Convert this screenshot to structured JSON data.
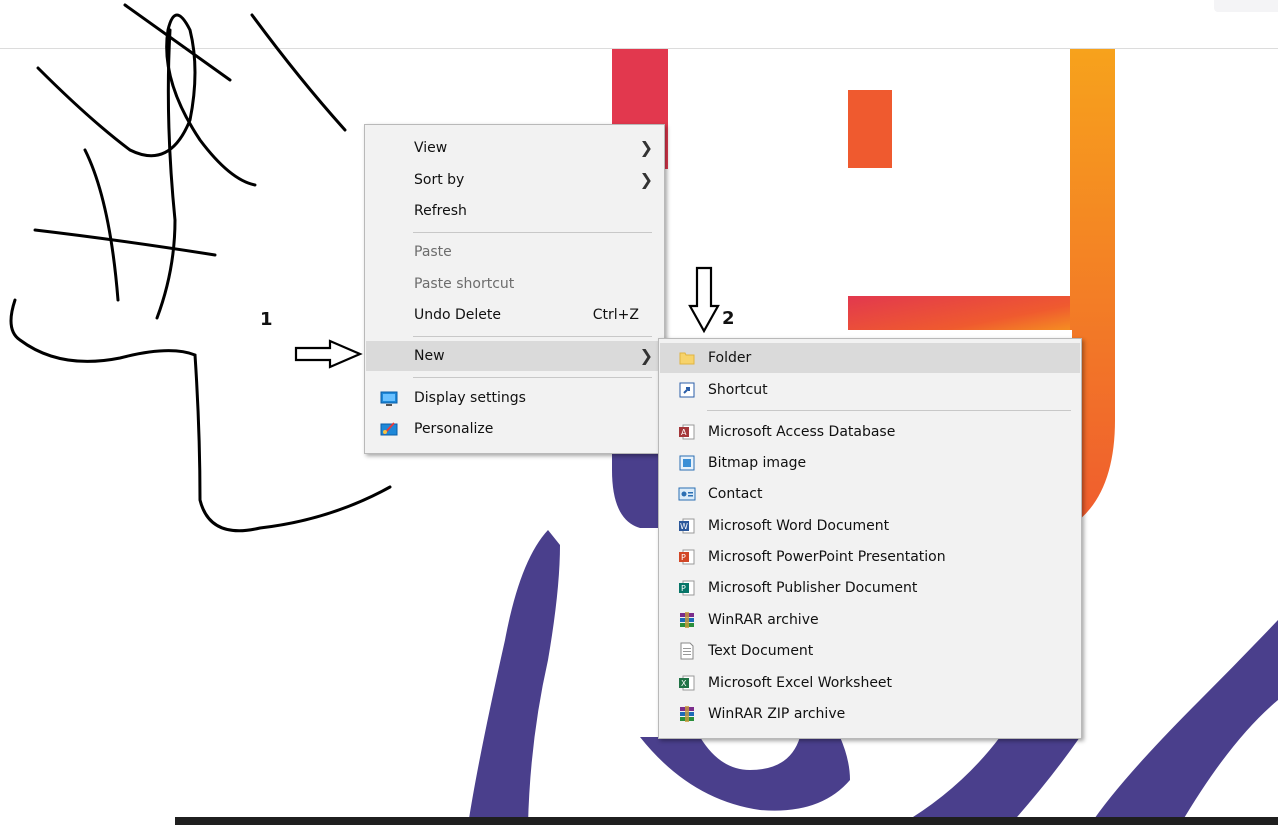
{
  "context_menu": {
    "items": [
      {
        "label": "View",
        "submenu": true
      },
      {
        "label": "Sort by",
        "submenu": true
      },
      {
        "label": "Refresh"
      },
      {
        "label": "Paste",
        "disabled": true
      },
      {
        "label": "Paste shortcut",
        "disabled": true
      },
      {
        "label": "Undo Delete",
        "shortcut": "Ctrl+Z"
      },
      {
        "label": "New",
        "submenu": true,
        "highlighted": true
      },
      {
        "label": "Display settings",
        "icon": "display-icon"
      },
      {
        "label": "Personalize",
        "icon": "personalize-icon"
      }
    ]
  },
  "new_submenu": {
    "items": [
      {
        "label": "Folder",
        "icon": "folder-icon",
        "highlighted": true
      },
      {
        "label": "Shortcut",
        "icon": "shortcut-icon"
      },
      {
        "label": "Microsoft Access Database",
        "icon": "access-icon"
      },
      {
        "label": "Bitmap image",
        "icon": "bitmap-icon"
      },
      {
        "label": "Contact",
        "icon": "contact-icon"
      },
      {
        "label": "Microsoft Word Document",
        "icon": "word-icon"
      },
      {
        "label": "Microsoft PowerPoint Presentation",
        "icon": "powerpoint-icon"
      },
      {
        "label": "Microsoft Publisher Document",
        "icon": "publisher-icon"
      },
      {
        "label": "WinRAR archive",
        "icon": "winrar-icon"
      },
      {
        "label": "Text Document",
        "icon": "text-document-icon"
      },
      {
        "label": "Microsoft Excel Worksheet",
        "icon": "excel-icon"
      },
      {
        "label": "WinRAR ZIP archive",
        "icon": "winrar-zip-icon"
      }
    ]
  },
  "annotations": {
    "step1": "1",
    "step2": "2"
  },
  "colors": {
    "menu_bg": "#f2f2f2",
    "highlight": "#dadada",
    "logo_orange": "#ef5a2f",
    "logo_red": "#e2384e",
    "logo_purple": "#4a3f8c"
  }
}
